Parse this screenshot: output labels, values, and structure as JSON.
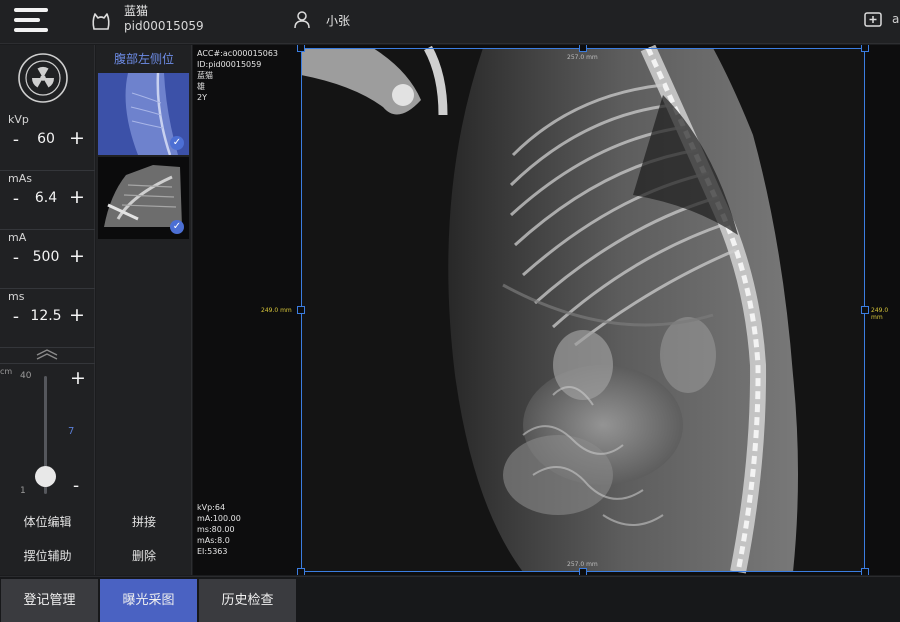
{
  "header": {
    "menu_icon": "hamburger-menu-icon",
    "pet_icon": "cat-head-icon",
    "pet_name": "蓝猫",
    "pet_id": "pid00015059",
    "user_icon": "user-icon",
    "user_name": "小张",
    "add_icon": "add-patient-icon",
    "add_label": "a"
  },
  "exposure": {
    "radiation_icon": "radiation-icon",
    "params": [
      {
        "label": "kVp",
        "value": "60"
      },
      {
        "label": "mAs",
        "value": "6.4"
      },
      {
        "label": "mA",
        "value": "500"
      },
      {
        "label": "ms",
        "value": "12.5"
      }
    ],
    "minus_symbol": "-",
    "plus_symbol": "+",
    "collapse_icon": "chevron-up-icon",
    "thickness": {
      "unit": "cm",
      "max": "40",
      "min": "1",
      "current": "7",
      "level": 0.15
    },
    "buttons": [
      "体位编辑",
      "摆位辅助"
    ]
  },
  "thumbnails": {
    "title": "腹部左侧位",
    "check_icon": "check-icon",
    "check_glyph": "✓",
    "buttons": [
      "拼接",
      "删除"
    ]
  },
  "viewer": {
    "info_top": [
      "ACC#:ac000015063",
      "ID:pid00015059",
      "蓝猫",
      "雄",
      "2Y"
    ],
    "info_bottom": [
      "kVp:64",
      "mA:100.00",
      "ms:80.00",
      "mAs:8.0",
      "EI:5363"
    ],
    "width_label": "257.0 mm",
    "height_label": "249.0 mm",
    "accent": "#3b7de0"
  },
  "tabs": [
    {
      "label": "登记管理",
      "active": false
    },
    {
      "label": "曝光采图",
      "active": true
    },
    {
      "label": "历史检查",
      "active": false
    }
  ],
  "colors": {
    "accent_blue": "#4a62c2",
    "selection_blue": "#3b7de0",
    "highlight_text": "#6d8ce6"
  }
}
